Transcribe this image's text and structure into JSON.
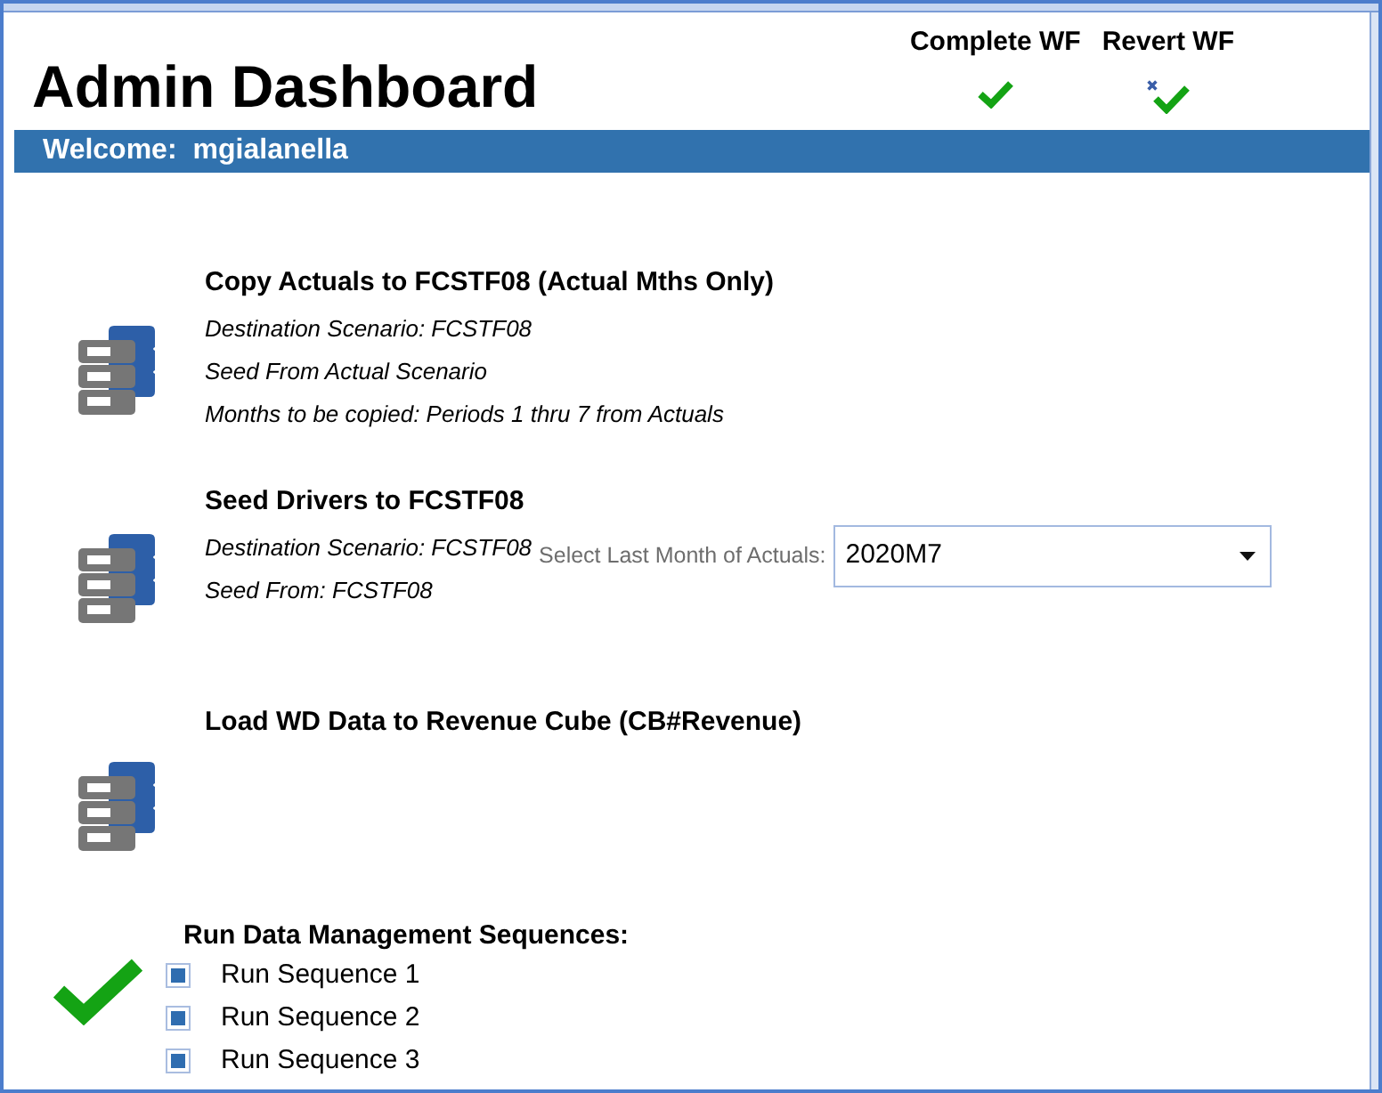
{
  "window": {
    "title": "Admin Dashboard"
  },
  "workflow_actions": [
    {
      "label": "Complete WF",
      "kind": "complete"
    },
    {
      "label": "Revert WF",
      "kind": "revert"
    }
  ],
  "welcome_bar": {
    "label": "Welcome:",
    "user": "mgialanella"
  },
  "steps": [
    {
      "title": "Copy Actuals to FCSTF08 (Actual Mths Only)",
      "details": [
        "Destination Scenario: FCSTF08",
        "Seed From Actual Scenario",
        "Months to be copied: Periods 1 thru 7 from Actuals"
      ]
    },
    {
      "title": "Seed Drivers to FCSTF08",
      "details": [
        "Destination Scenario: FCSTF08",
        "Seed From: FCSTF08"
      ],
      "select": {
        "label": "Select Last Month of Actuals:",
        "value": "2020M7"
      }
    },
    {
      "title": "Load WD Data to Revenue Cube (CB#Revenue)"
    }
  ],
  "sequences": {
    "title": "Run Data Management Sequences:",
    "items": [
      {
        "label": "Run Sequence 1",
        "checked": true
      },
      {
        "label": "Run Sequence 2",
        "checked": true
      },
      {
        "label": "Run Sequence 3",
        "checked": true
      }
    ]
  }
}
